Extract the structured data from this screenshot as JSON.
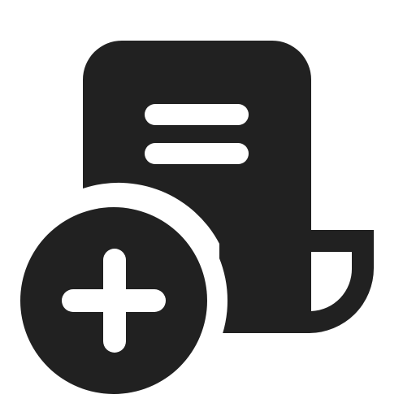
{
  "icon": {
    "name": "receipt-add-icon",
    "colors": {
      "glyph": "#212121",
      "background": "#ffffff"
    }
  }
}
